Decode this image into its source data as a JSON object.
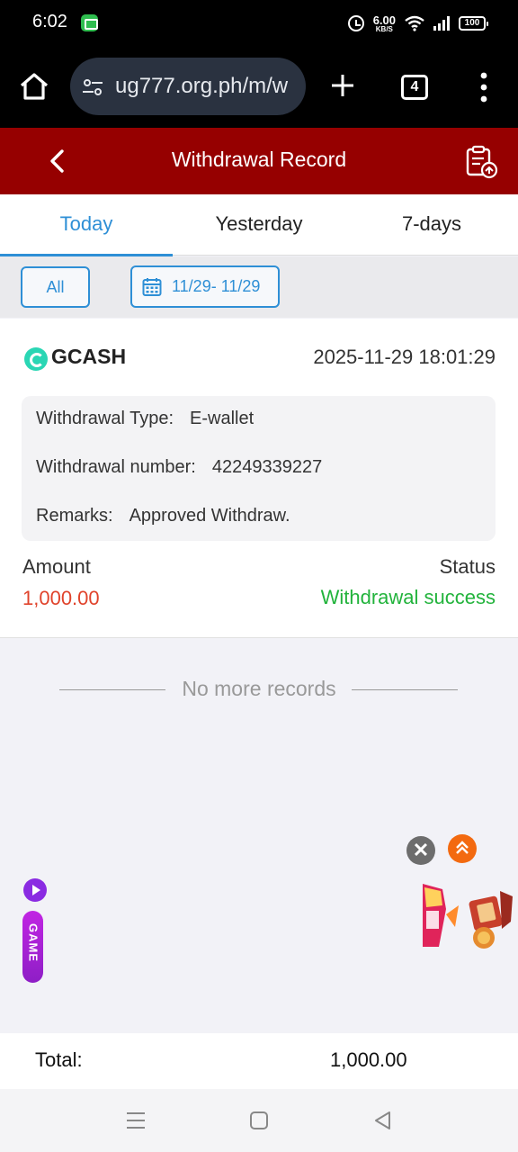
{
  "status_bar": {
    "time": "6:02",
    "net_speed_value": "6.00",
    "net_speed_unit": "KB/S",
    "battery": "100"
  },
  "browser": {
    "url": "ug777.org.ph/m/w",
    "tab_count": "4"
  },
  "header": {
    "title": "Withdrawal Record"
  },
  "tabs": [
    {
      "label": "Today",
      "active": true
    },
    {
      "label": "Yesterday",
      "active": false
    },
    {
      "label": "7-days",
      "active": false
    }
  ],
  "filters": {
    "all_label": "All",
    "date_range": "11/29- 11/29"
  },
  "record": {
    "method": "GCASH",
    "datetime": "2025-11-29 18:01:29",
    "type_label": "Withdrawal Type:",
    "type_value": "E-wallet",
    "number_label": "Withdrawal number:",
    "number_value": "42249339227",
    "remarks_label": "Remarks:",
    "remarks_value": "Approved Withdraw.",
    "amount_label": "Amount",
    "amount_value": "1,000.00",
    "status_label": "Status",
    "status_value": "Withdrawal success"
  },
  "list_end": "No more records",
  "floating": {
    "close_symbol": "✕",
    "game_label": "GAME"
  },
  "footer": {
    "total_label": "Total:",
    "total_value": "1,000.00"
  },
  "colors": {
    "header_bg": "#960000",
    "accent": "#2e8fd6",
    "amount": "#e0432b",
    "success": "#22b33c"
  }
}
